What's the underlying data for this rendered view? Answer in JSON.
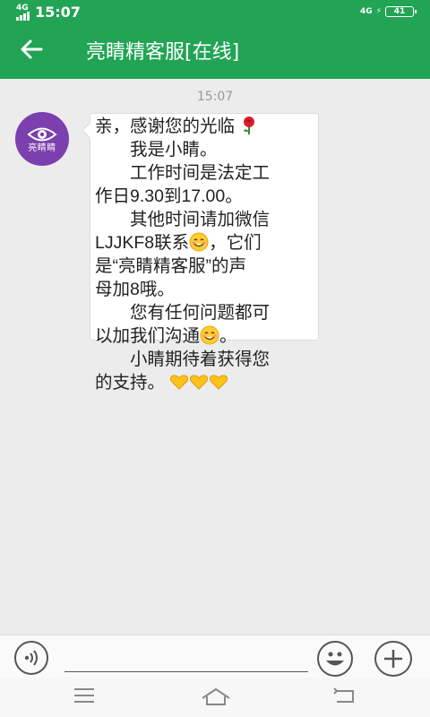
{
  "status_bar": {
    "network": "4G",
    "time": "15:07",
    "network_right": "4G",
    "battery": "41"
  },
  "header": {
    "back_icon": "arrow-left-icon",
    "title": "亮睛精客服[在线]"
  },
  "chat": {
    "timestamp": "15:07",
    "agent": {
      "avatar_text": "亮睛睛"
    },
    "message_lines": [
      "亲，感谢您的光临",
      "　　我是小睛。",
      "　　工作时间是法定工",
      "作日9.30到17.00。",
      "　　其他时间请加微信",
      "LJJKF8联系",
      "，它们",
      "是“亮睛精客服”的声",
      "母加8哦。",
      "　　您有任何问题都可",
      "以加我们沟通",
      "。",
      "　　小睛期待着获得您",
      "的支持。"
    ]
  },
  "input_bar": {
    "placeholder": ""
  },
  "colors": {
    "header": "#22a455",
    "avatar": "#7c3fae"
  }
}
